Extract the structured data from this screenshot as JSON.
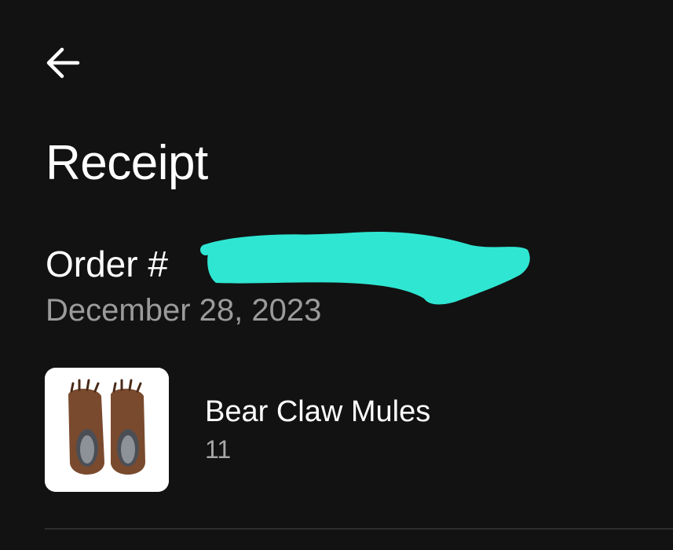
{
  "header": {
    "back_icon": "arrow-left-icon",
    "title": "Receipt"
  },
  "order": {
    "number_label": "Order #",
    "date": "December 28, 2023",
    "redaction_color": "#2fe6d2"
  },
  "items": [
    {
      "name": "Bear Claw Mules",
      "size": "11",
      "image": "bear-claw-mules-thumbnail"
    }
  ],
  "colors": {
    "background": "#121212",
    "text": "#ffffff",
    "secondary_text": "#9b9b9b",
    "divider": "#2e2e2e"
  }
}
